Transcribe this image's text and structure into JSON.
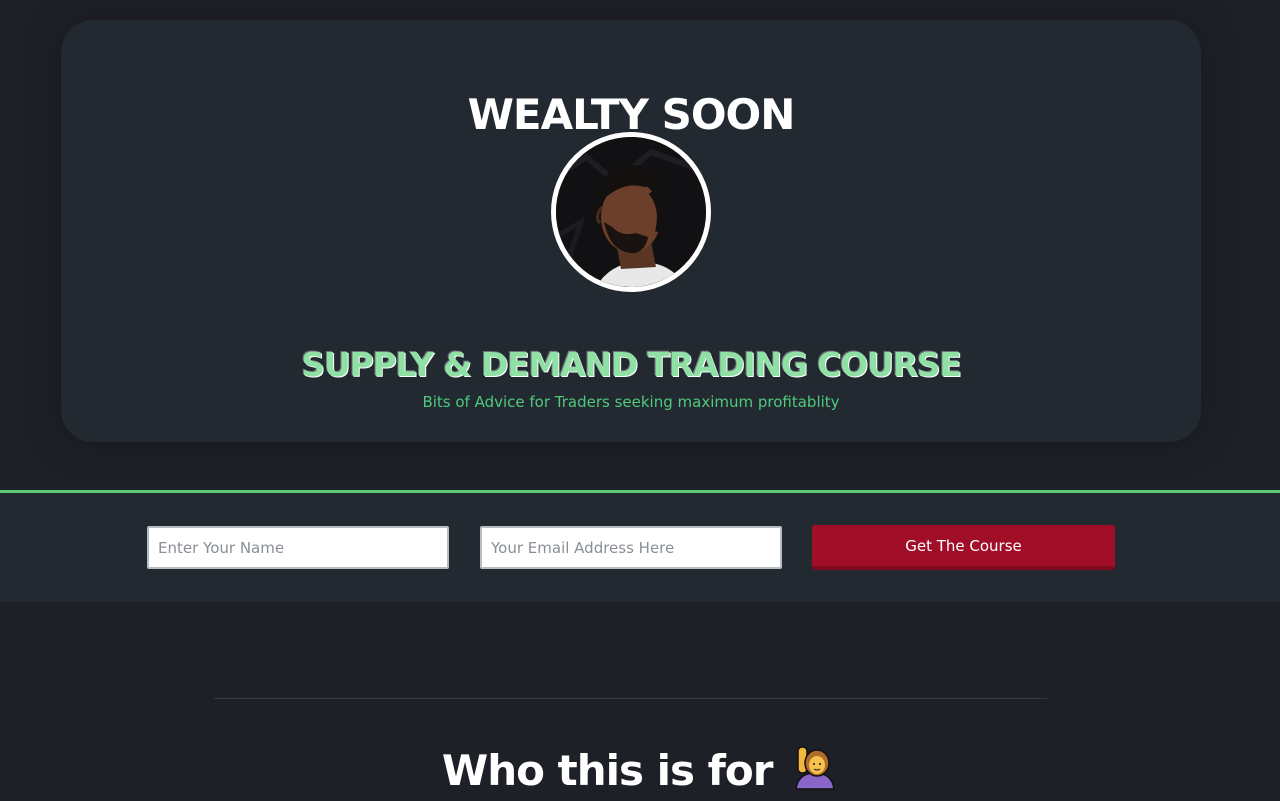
{
  "hero": {
    "brand": "WEALTY SOON",
    "course_title": "SUPPLY & DEMAND TRADING COURSE",
    "subtitle": "Bits of Advice for Traders seeking maximum profitablity",
    "accent_color": "#5bc777"
  },
  "signup": {
    "name_placeholder": "Enter Your Name",
    "email_placeholder": "Your Email Address Here",
    "button_label": "Get The Course",
    "button_color": "#a10e28"
  },
  "section": {
    "heading": "Who this is for",
    "emoji_icon": "person-raising-hand-icon"
  }
}
